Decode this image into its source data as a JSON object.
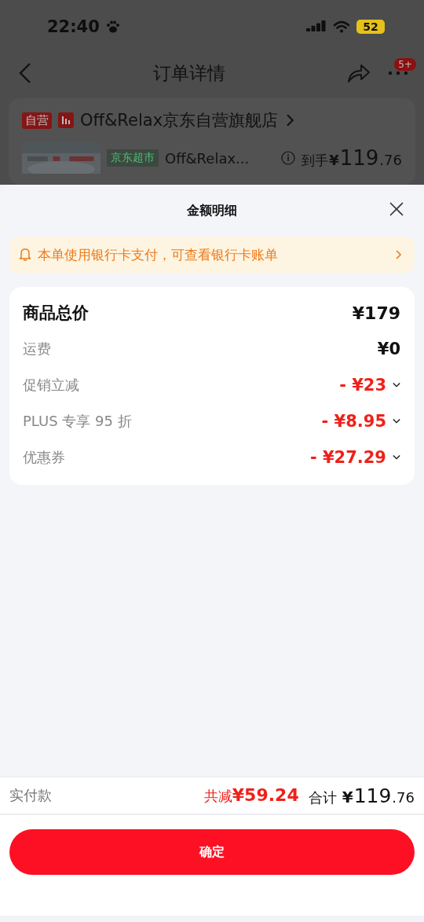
{
  "status_bar": {
    "time": "22:40",
    "battery": "52"
  },
  "nav": {
    "title": "订单详情",
    "badge": "5+"
  },
  "store": {
    "tag": "自营",
    "name": "Off&Relax京东自营旗舰店"
  },
  "product": {
    "tag": "京东超市",
    "title": "Off&Relax...",
    "price_label": "到手",
    "currency": "¥",
    "price_integer": "119",
    "price_decimal": ".76"
  },
  "sheet": {
    "title": "金额明细",
    "notice": "本单使用银行卡支付，可查看银行卡账单",
    "rows": [
      {
        "kind": "total",
        "label": "商品总价",
        "amount": "¥179"
      },
      {
        "kind": "plain",
        "label": "运费",
        "amount": "¥0"
      },
      {
        "kind": "discount",
        "label": "促销立减",
        "amount": "- ¥23",
        "expanded": false
      },
      {
        "kind": "discount",
        "label": "PLUS 专享 95 折",
        "amount": "- ¥8.95",
        "expanded": false
      },
      {
        "kind": "discount",
        "label": "优惠券",
        "amount": "- ¥27.29",
        "expanded": false
      }
    ],
    "summary": {
      "label": "实付款",
      "saved_label": "共减",
      "saved_amount": "¥59.24",
      "total_label": "合计",
      "currency": "¥",
      "total_integer": "119",
      "total_decimal": ".76"
    },
    "confirm": "确定"
  }
}
